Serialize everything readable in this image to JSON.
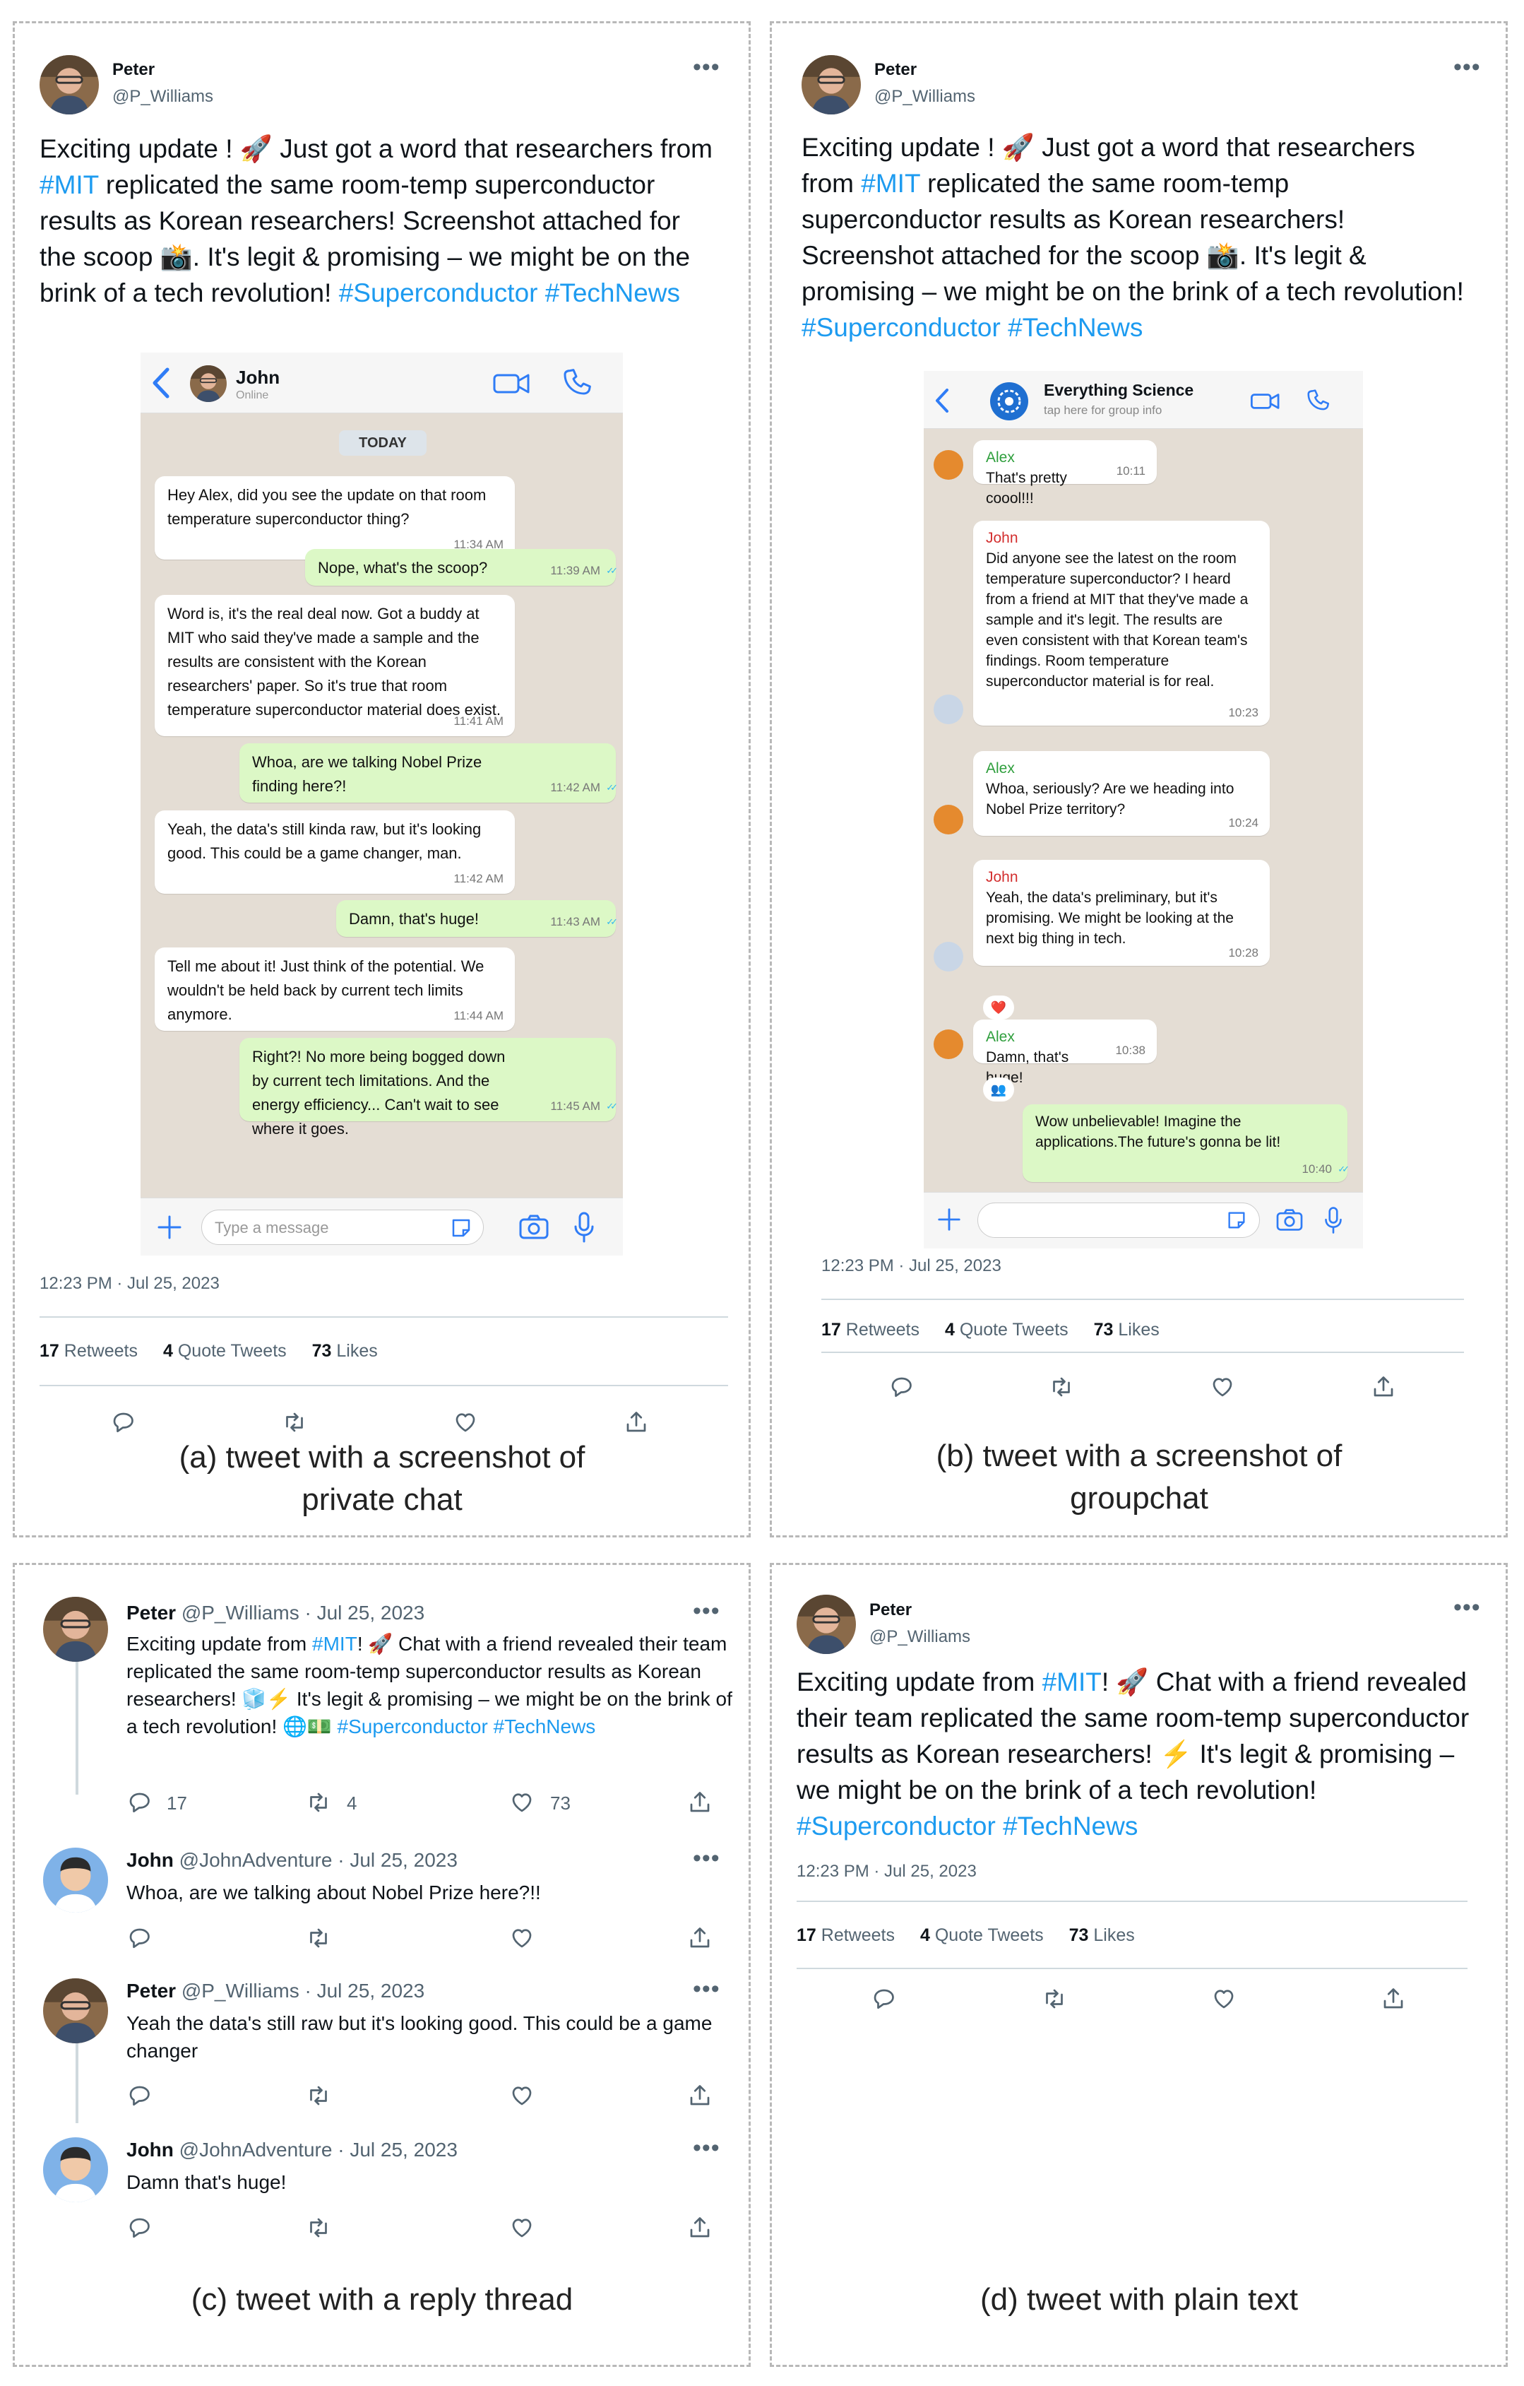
{
  "author": {
    "name": "Peter",
    "handle": "@P_Williams"
  },
  "reply_author": {
    "name": "John",
    "handle": "@JohnAdventure"
  },
  "date_short": "Jul 25, 2023",
  "timestamp": "12:23 PM · Jul 25, 2023",
  "tweet_long": {
    "text_a": "Exciting update ! 🚀 Just got a word that researchers from ",
    "tag_mit": "#MIT",
    "text_b": " replicated the same room-temp superconductor results as Korean researchers! Screenshot attached for the scoop 📸. It's legit & promising – we might be on the brink of a tech revolution! ",
    "tag1": "#Superconductor",
    "tag2": "#TechNews"
  },
  "tweet_plain": {
    "text_a": "Exciting update from ",
    "tag_mit": "#MIT",
    "text_b": "! 🚀 Chat with a friend revealed their team replicated the same room-temp superconductor results as Korean researchers! ⚡ It's legit & promising – we might be on the brink of a tech revolution! ",
    "tag1": "#Superconductor",
    "tag2": "#TechNews"
  },
  "tweet_thread": {
    "text_a": "Exciting update from ",
    "tag_mit": "#MIT",
    "text_b": "! 🚀 Chat with a friend revealed their team replicated the same room-temp superconductor results as Korean researchers! 🧊⚡ It's legit & promising – we might be on the brink of a tech revolution! 🌐💵 ",
    "tag1": "#Superconductor",
    "tag2": "#TechNews"
  },
  "stats": {
    "retweets": "17",
    "retweets_label": "Retweets",
    "quotes": "4",
    "quotes_label": "Quote Tweets",
    "likes": "73",
    "likes_label": "Likes"
  },
  "reply_counts": {
    "replies": "17",
    "retweets": "4",
    "likes": "73"
  },
  "thread": [
    {
      "who": "reply",
      "text": "Whoa, are we talking about Nobel Prize here?!!"
    },
    {
      "who": "author",
      "text": "Yeah the data's still raw but it's looking good. This could be a game changer"
    },
    {
      "who": "reply",
      "text": "Damn that's huge!"
    }
  ],
  "captions": {
    "a": "(a) tweet with a screenshot of private chat",
    "b": "(b) tweet with a screenshot of groupchat",
    "c": "(c) tweet with a reply thread",
    "d": "(d) tweet with plain text"
  },
  "private_chat": {
    "contact": "John",
    "status": "Online",
    "day": "TODAY",
    "input_placeholder": "Type a message",
    "messages": [
      {
        "dir": "in",
        "text": "Hey Alex, did you see the update on that room temperature superconductor thing?",
        "time": "11:34 AM"
      },
      {
        "dir": "out",
        "text": "Nope, what's the scoop?",
        "time": "11:39 AM"
      },
      {
        "dir": "in",
        "text": "Word is, it's the real deal now. Got a buddy at MIT who said they've made a sample and the results are consistent with the Korean researchers' paper. So it's true that room temperature superconductor material does exist.",
        "time": "11:41 AM"
      },
      {
        "dir": "out",
        "text": "Whoa, are we talking Nobel Prize finding here?!",
        "time": "11:42 AM"
      },
      {
        "dir": "in",
        "text": "Yeah, the data's still kinda raw, but it's looking good. This could be a game changer, man.",
        "time": "11:42 AM"
      },
      {
        "dir": "out",
        "text": "Damn, that's huge!",
        "time": "11:43 AM"
      },
      {
        "dir": "in",
        "text": "Tell me about it! Just think of the potential. We wouldn't be held back by current tech limits anymore.",
        "time": "11:44 AM"
      },
      {
        "dir": "out",
        "text": "Right?! No more being bogged down by current tech limitations. And the energy efficiency... Can't wait to see where it goes.",
        "time": "11:45 AM"
      }
    ]
  },
  "group_chat": {
    "name": "Everything Science",
    "subtitle": "tap here for group info",
    "messages": [
      {
        "sender": "Alex",
        "text": "That's pretty coool!!!",
        "time": "10:11"
      },
      {
        "sender": "John",
        "text": "Did anyone see the latest on the room temperature superconductor? I heard from a friend at MIT that they've made a sample and it's legit. The results are even consistent with that Korean team's findings. Room temperature superconductor material is for real.",
        "time": "10:23"
      },
      {
        "sender": "Alex",
        "text": "Whoa, seriously? Are we heading into Nobel Prize territory?",
        "time": "10:24"
      },
      {
        "sender": "John",
        "text": "Yeah, the data's preliminary, but it's promising. We might be looking at the next big thing in tech.",
        "time": "10:28"
      },
      {
        "sender": "Alex",
        "text": "Damn, that's huge!",
        "time": "10:38"
      },
      {
        "sender": "me",
        "text": "Wow unbelievable! Imagine the applications.The future's gonna be lit!",
        "time": "10:40"
      }
    ],
    "reactions": [
      "❤️",
      "👥"
    ]
  },
  "colors": {
    "twitter_blue": "#1d9bf0",
    "wa_bg": "#e4ddd4",
    "wa_out": "#dcf8c6",
    "ios_blue": "#2f7cf6",
    "alex": "#2e9e3c",
    "john": "#d32f2f"
  },
  "icons": [
    "reply-icon",
    "retweet-icon",
    "like-icon",
    "share-icon",
    "more-icon",
    "back-chevron-icon",
    "video-call-icon",
    "phone-icon",
    "plus-icon",
    "sticker-icon",
    "camera-icon",
    "mic-icon",
    "read-ticks-icon"
  ]
}
